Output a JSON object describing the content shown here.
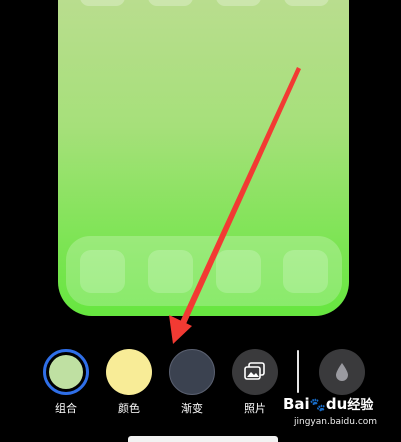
{
  "colors": {
    "wallpaper_top": "#b9dd8e",
    "wallpaper_bottom": "#66e63f",
    "selected_ring": "#2f6fe8",
    "arrow": "#f23a33",
    "combo_fill": "#bfe0a2",
    "color_fill": "#f8ec97",
    "gradient_fill": "#3b4250",
    "photo_fill": "#3a3a3c"
  },
  "options": [
    {
      "label": "组合",
      "icon": "combination-swatch-icon",
      "selected": true
    },
    {
      "label": "颜色",
      "icon": "color-swatch-icon",
      "selected": false
    },
    {
      "label": "渐变",
      "icon": "gradient-swatch-icon",
      "selected": false
    },
    {
      "label": "照片",
      "icon": "photos-icon",
      "selected": false
    }
  ],
  "blur_button": {
    "icon": "droplet-icon"
  },
  "watermark": {
    "brand": "Bai",
    "paw": "du",
    "suffix": "经验",
    "url": "jingyan.baidu.com"
  }
}
